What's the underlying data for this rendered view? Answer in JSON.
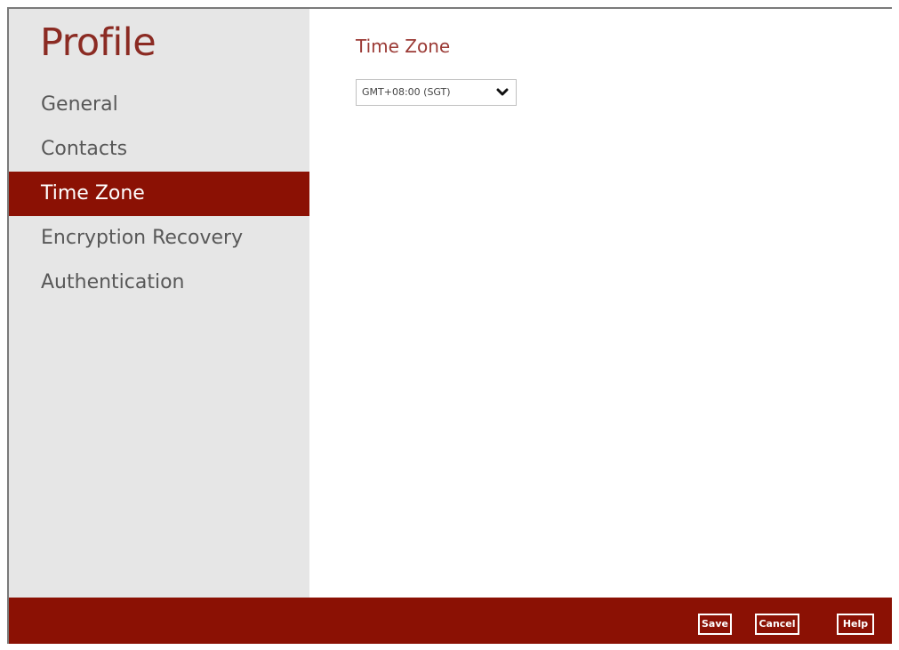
{
  "sidebar": {
    "title": "Profile",
    "items": [
      {
        "label": "General"
      },
      {
        "label": "Contacts"
      },
      {
        "label": "Time Zone"
      },
      {
        "label": "Encryption Recovery"
      },
      {
        "label": "Authentication"
      }
    ],
    "active_item": "Time Zone"
  },
  "main": {
    "section_title": "Time Zone",
    "timezone_select": {
      "value": "GMT+08:00 (SGT)",
      "icon": "chevron-down-icon"
    }
  },
  "footer": {
    "save_label": "Save",
    "cancel_label": "Cancel",
    "help_label": "Help"
  },
  "colors": {
    "accent": "#8b1104",
    "title": "#8b2b23",
    "sidebar_bg": "#e6e6e6",
    "nav_text": "#585858"
  }
}
